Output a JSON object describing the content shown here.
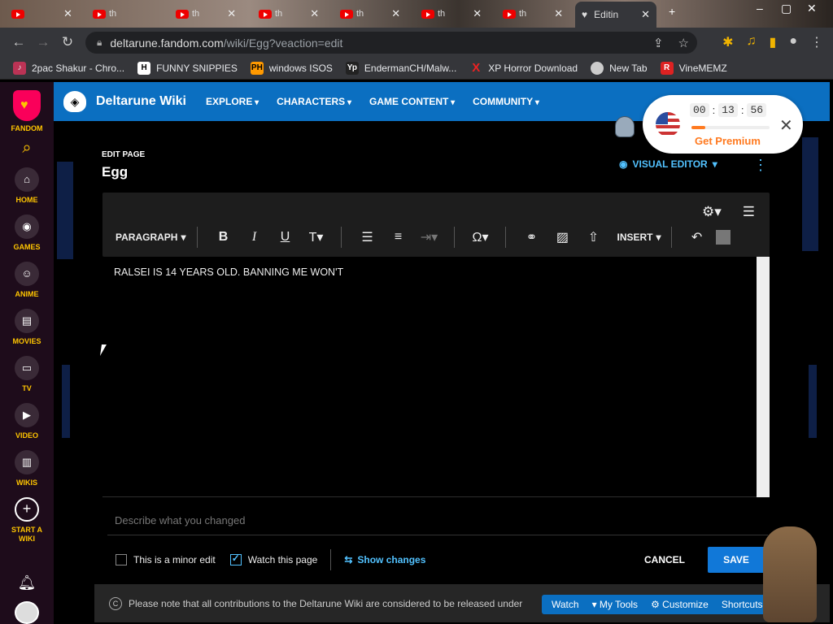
{
  "browser": {
    "tabs": [
      {
        "label": "th"
      },
      {
        "label": "th"
      },
      {
        "label": "th"
      },
      {
        "label": "th"
      },
      {
        "label": "th"
      },
      {
        "label": "th"
      }
    ],
    "active_tab_label": "Editin",
    "url_host": "deltarune.fandom.com",
    "url_path": "/wiki/Egg?veaction=edit",
    "bookmarks": [
      {
        "label": "2pac Shakur - Chro...",
        "icon": "bookmark-2pac-icon"
      },
      {
        "label": "FUNNY SNIPPIES",
        "icon": "bookmark-h-icon"
      },
      {
        "label": "windows ISOS",
        "icon": "bookmark-ph-icon"
      },
      {
        "label": "EndermanCH/Malw...",
        "icon": "bookmark-yp-icon"
      },
      {
        "label": "XP Horror Download",
        "icon": "bookmark-x-icon"
      },
      {
        "label": "New Tab",
        "icon": "bookmark-newtab-icon"
      },
      {
        "label": "VineMEMZ",
        "icon": "bookmark-r-icon"
      }
    ]
  },
  "rail": {
    "brand": "FANDOM",
    "items": [
      {
        "label": "HOME",
        "icon": "home-icon"
      },
      {
        "label": "GAMES",
        "icon": "games-icon"
      },
      {
        "label": "ANIME",
        "icon": "anime-icon"
      },
      {
        "label": "MOVIES",
        "icon": "movies-icon"
      },
      {
        "label": "TV",
        "icon": "tv-icon"
      },
      {
        "label": "VIDEO",
        "icon": "video-icon"
      },
      {
        "label": "WIKIS",
        "icon": "wikis-icon"
      },
      {
        "label": "START A WIKI",
        "icon": "plus-icon"
      }
    ]
  },
  "wiki": {
    "name": "Deltarune Wiki",
    "nav": [
      "EXPLORE",
      "CHARACTERS",
      "GAME CONTENT",
      "COMMUNITY"
    ]
  },
  "editor": {
    "kicker": "EDIT PAGE",
    "title": "Egg",
    "mode": "VISUAL EDITOR",
    "format": "PARAGRAPH",
    "insert": "INSERT",
    "content": "RALSEI IS 14 YEARS OLD. BANNING ME WON'T",
    "summary_placeholder": "Describe what you changed",
    "minor_edit": "This is a minor edit",
    "watch_page": "Watch this page",
    "show_changes": "Show changes",
    "cancel": "CANCEL",
    "save": "SAVE"
  },
  "footer": {
    "notice": "Please note that all contributions to the Deltarune Wiki are considered to be released under",
    "tools": [
      "Watch",
      "My Tools",
      "Customize",
      "Shortcuts"
    ]
  },
  "timer_popup": {
    "hours": "00",
    "minutes": "13",
    "seconds": "56",
    "progress": 0.18,
    "cta": "Get Premium"
  },
  "colors": {
    "fandom_accent": "#ffc500",
    "wiki_blue": "#0b6fc1",
    "link_blue": "#52c2ff",
    "premium_orange": "#ff7a20"
  }
}
